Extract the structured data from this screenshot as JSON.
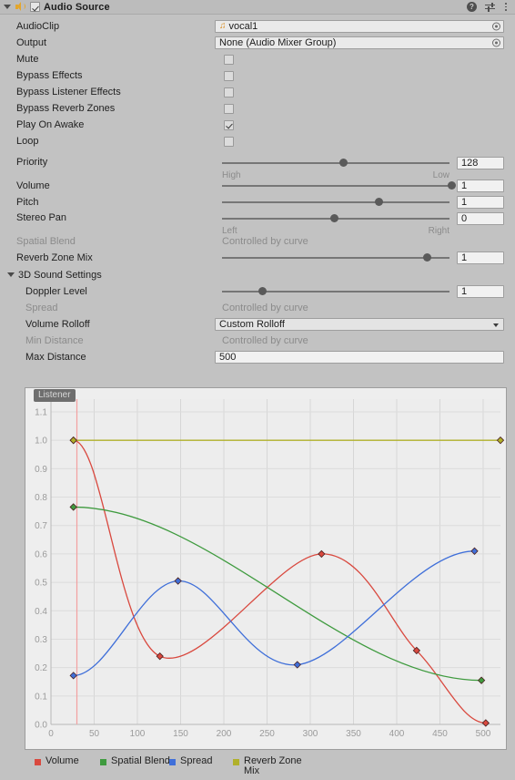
{
  "header": {
    "title": "Audio Source",
    "enabled_checkbox": true,
    "icons": [
      "foldout-triangle-icon",
      "audio-source-icon",
      "help-icon",
      "preset-icon",
      "more-menu-icon"
    ]
  },
  "properties": {
    "audio_clip": {
      "label": "AudioClip",
      "value": "vocal1"
    },
    "output": {
      "label": "Output",
      "value": "None (Audio Mixer Group)"
    },
    "mute": {
      "label": "Mute",
      "checked": false
    },
    "bypass_effects": {
      "label": "Bypass Effects",
      "checked": false
    },
    "bypass_listener_effects": {
      "label": "Bypass Listener Effects",
      "checked": false
    },
    "bypass_reverb_zones": {
      "label": "Bypass Reverb Zones",
      "checked": false
    },
    "play_on_awake": {
      "label": "Play On Awake",
      "checked": true
    },
    "loop": {
      "label": "Loop",
      "checked": false
    },
    "priority": {
      "label": "Priority",
      "value": "128",
      "left_end": "High",
      "right_end": "Low",
      "knob_pct": 54
    },
    "volume": {
      "label": "Volume",
      "value": "1",
      "knob_pct": 100
    },
    "pitch": {
      "label": "Pitch",
      "value": "1",
      "knob_pct": 69
    },
    "stereo_pan": {
      "label": "Stereo Pan",
      "value": "0",
      "left_end": "Left",
      "right_end": "Right",
      "knob_pct": 50
    },
    "spatial_blend": {
      "label": "Spatial Blend",
      "value": "Controlled by curve"
    },
    "reverb_zone_mix": {
      "label": "Reverb Zone Mix",
      "value": "1",
      "knob_pct": 90
    }
  },
  "sound_3d": {
    "section_label": "3D Sound Settings",
    "doppler_level": {
      "label": "Doppler Level",
      "value": "1",
      "knob_pct": 20
    },
    "spread": {
      "label": "Spread",
      "value": "Controlled by curve"
    },
    "volume_rolloff": {
      "label": "Volume Rolloff",
      "value": "Custom Rolloff"
    },
    "min_distance": {
      "label": "Min Distance",
      "value": "Controlled by curve"
    },
    "max_distance": {
      "label": "Max Distance",
      "value": "500"
    }
  },
  "graph": {
    "listener_label": "Listener",
    "listener_x": 30,
    "legend": [
      {
        "name": "Volume",
        "color": "#d9493f"
      },
      {
        "name": "Spatial Blend",
        "color": "#3f9b3f"
      },
      {
        "name": "Spread",
        "color": "#3f6fd9"
      },
      {
        "name": "Reverb Zone Mix",
        "color": "#b0b02a"
      }
    ]
  },
  "chart_data": {
    "type": "line",
    "title": "",
    "xlabel": "",
    "ylabel": "",
    "xlim": [
      0,
      520
    ],
    "ylim": [
      0.0,
      1.1
    ],
    "xticks": [
      0,
      50,
      100,
      150,
      200,
      250,
      300,
      350,
      400,
      450,
      500
    ],
    "yticks": [
      0.0,
      0.1,
      0.2,
      0.3,
      0.4,
      0.5,
      0.6,
      0.7,
      0.8,
      0.9,
      1.0,
      1.1
    ],
    "grid": true,
    "legend_position": "below",
    "series": [
      {
        "name": "Volume",
        "color": "#d9493f",
        "keys": [
          {
            "x": 26,
            "y": 1.0
          },
          {
            "x": 126,
            "y": 0.24
          },
          {
            "x": 313,
            "y": 0.6
          },
          {
            "x": 423,
            "y": 0.26
          },
          {
            "x": 503,
            "y": 0.005
          }
        ]
      },
      {
        "name": "Spatial Blend",
        "color": "#3f9b3f",
        "keys": [
          {
            "x": 26,
            "y": 0.765
          },
          {
            "x": 498,
            "y": 0.155
          }
        ]
      },
      {
        "name": "Spread",
        "color": "#3f6fd9",
        "keys": [
          {
            "x": 26,
            "y": 0.172
          },
          {
            "x": 147,
            "y": 0.505
          },
          {
            "x": 285,
            "y": 0.21
          },
          {
            "x": 490,
            "y": 0.61
          }
        ]
      },
      {
        "name": "Reverb Zone Mix",
        "color": "#b0b02a",
        "keys": [
          {
            "x": 26,
            "y": 1.0
          },
          {
            "x": 520,
            "y": 1.0
          }
        ]
      }
    ]
  }
}
